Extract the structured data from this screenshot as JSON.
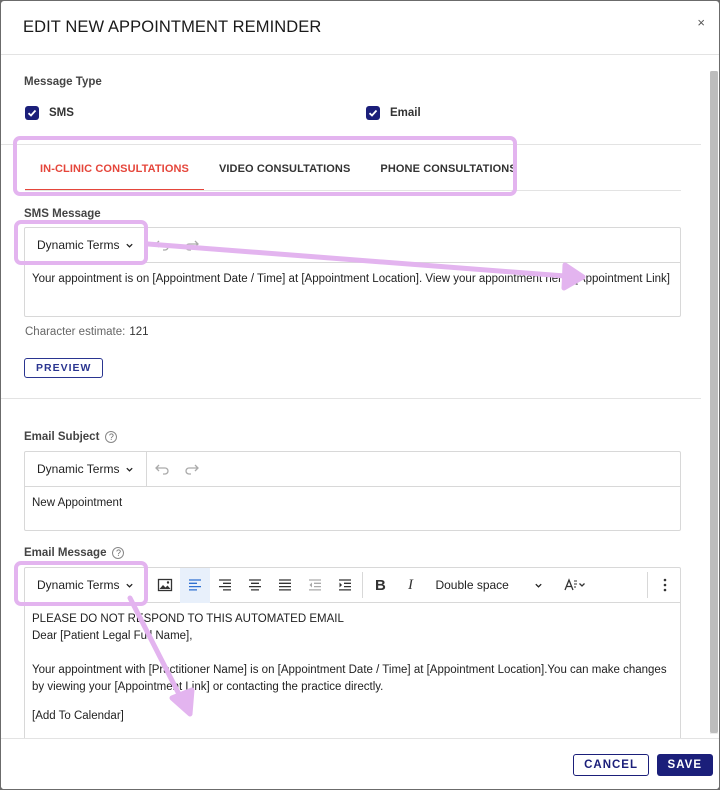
{
  "modal": {
    "title": "EDIT NEW APPOINTMENT REMINDER",
    "close_glyph": "×"
  },
  "message_type": {
    "label": "Message Type",
    "options": [
      {
        "label": "SMS",
        "checked": true
      },
      {
        "label": "Email",
        "checked": true
      }
    ]
  },
  "tabs": [
    {
      "label": "IN-CLINIC CONSULTATIONS",
      "active": true
    },
    {
      "label": "VIDEO CONSULTATIONS",
      "active": false
    },
    {
      "label": "PHONE CONSULTATIONS",
      "active": false
    }
  ],
  "sms": {
    "label": "SMS Message",
    "dynamic_terms": "Dynamic Terms",
    "body": "Your appointment is on [Appointment Date / Time] at [Appointment Location]. View your appointment here: [Appointment Link]",
    "char_estimate_label": "Character estimate:",
    "char_estimate_value": "121",
    "preview_label": "PREVIEW"
  },
  "email_subject": {
    "label": "Email Subject",
    "help_glyph": "?",
    "dynamic_terms": "Dynamic Terms",
    "body": "New Appointment"
  },
  "email_message": {
    "label": "Email Message",
    "help_glyph": "?",
    "dynamic_terms": "Dynamic Terms",
    "line_spacing": "Double space",
    "lines": [
      "PLEASE DO NOT RESPOND TO THIS AUTOMATED EMAIL",
      "Dear [Patient Legal Full Name],",
      "",
      "Your appointment with [Practitioner Name] is on [Appointment Date / Time] at [Appointment Location].You can make changes by viewing your [Appointment Link] or contacting the practice directly.",
      "[Add To Calendar]"
    ]
  },
  "footer": {
    "cancel_label": "CANCEL",
    "save_label": "SAVE"
  },
  "colors": {
    "accent": "#1b1f7a",
    "tab_active": "#e5463b",
    "highlight": "#e3b4ef"
  }
}
